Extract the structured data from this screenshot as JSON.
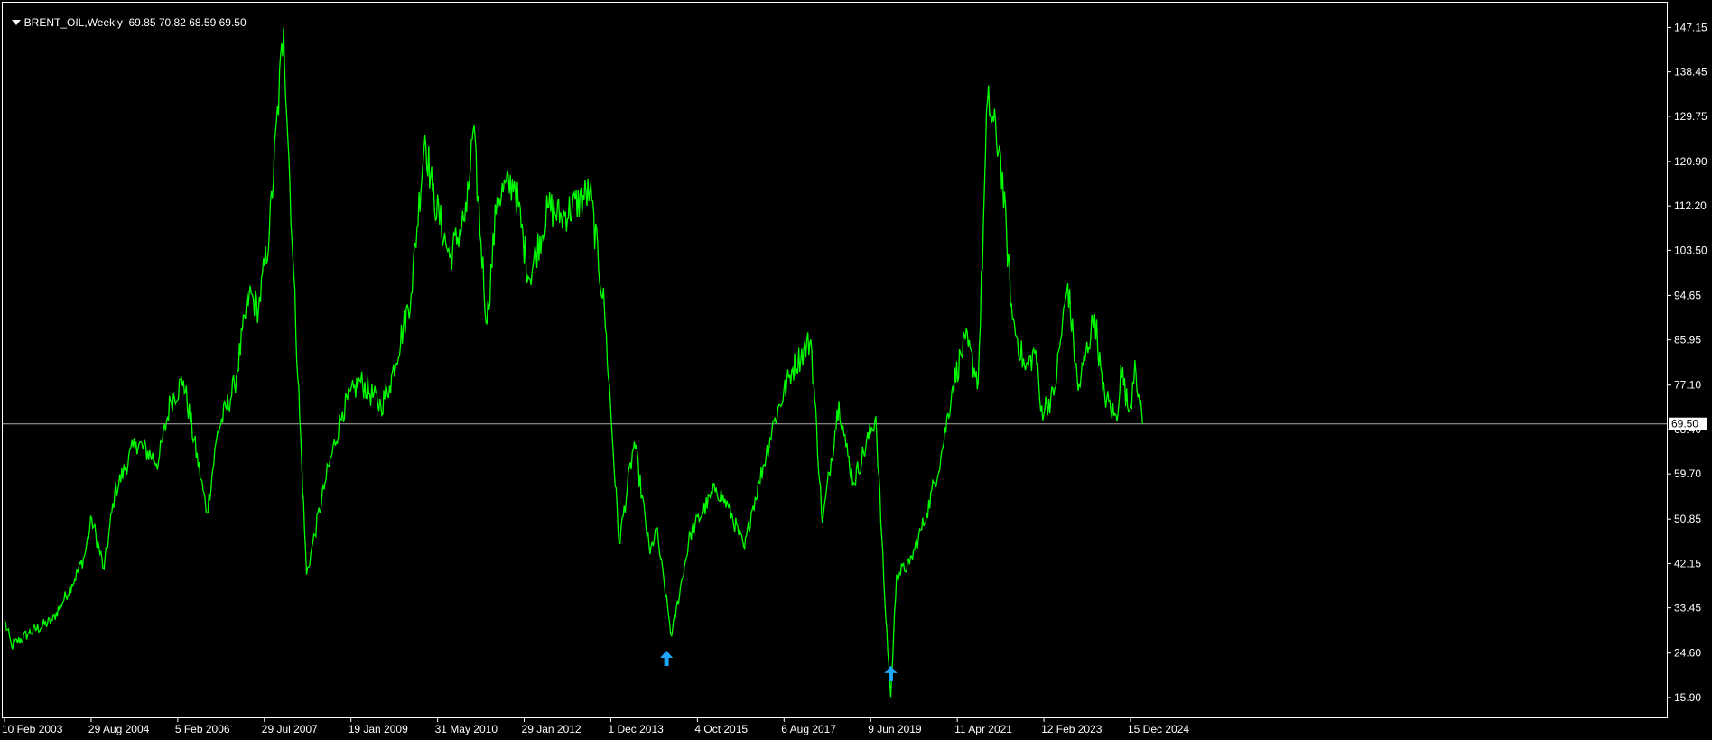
{
  "header": {
    "symbol": "BRENT_OIL,Weekly",
    "ohlc": "69.85 70.82 68.59 69.50"
  },
  "colors": {
    "background": "#000000",
    "price_line": "#00FF00",
    "arrow": "#1EA7FD",
    "grid_frame": "#FFFFFF",
    "current_line": "#B0B0B0"
  },
  "chart_data": {
    "type": "line",
    "title": "",
    "xlabel": "",
    "ylabel": "",
    "grid": false,
    "ylim": [
      12.0,
      152.0
    ],
    "y_ticks": [
      "147.15",
      "138.45",
      "129.75",
      "120.90",
      "112.20",
      "103.50",
      "94.65",
      "85.95",
      "77.10",
      "68.40",
      "59.70",
      "50.85",
      "42.15",
      "33.45",
      "24.60",
      "15.90"
    ],
    "x_ticks": [
      "10 Feb 2003",
      "29 Aug 2004",
      "5 Feb 2006",
      "29 Jul 2007",
      "19 Jan 2009",
      "31 May 2010",
      "29 Jan 2012",
      "1 Dec 2013",
      "4 Oct 2015",
      "6 Aug 2017",
      "9 Jun 2019",
      "11 Apr 2021",
      "12 Feb 2023",
      "15 Dec 2024"
    ],
    "current_value": "69.50",
    "series": [
      {
        "x": [
          "2003-02-10",
          "2003-04-01",
          "2003-08-01",
          "2004-01-15",
          "2004-06-01",
          "2004-08-29",
          "2004-10-20",
          "2005-01-15",
          "2005-04-01",
          "2005-08-30",
          "2006-02-05",
          "2006-05-01",
          "2006-08-01",
          "2007-01-15",
          "2007-04-01",
          "2007-07-29",
          "2007-11-10",
          "2008-01-15",
          "2008-04-01",
          "2008-07-11",
          "2008-09-15",
          "2008-12-20",
          "2009-01-19",
          "2009-05-01",
          "2009-09-01",
          "2010-01-01",
          "2010-05-31",
          "2010-08-01",
          "2011-01-01",
          "2011-04-08",
          "2011-06-01",
          "2011-10-01",
          "2012-01-29",
          "2012-03-15",
          "2012-06-20",
          "2012-09-01",
          "2013-01-01",
          "2013-04-15",
          "2013-09-01",
          "2013-12-01",
          "2014-06-20",
          "2014-10-01",
          "2015-01-13",
          "2015-05-01",
          "2015-08-20",
          "2015-10-04",
          "2016-01-20",
          "2016-06-01",
          "2016-12-01",
          "2017-03-01",
          "2017-06-20",
          "2017-08-06",
          "2017-10-01",
          "2018-01-15",
          "2018-05-20",
          "2018-10-03",
          "2018-12-24",
          "2019-04-20",
          "2019-06-09",
          "2019-08-01",
          "2020-01-06",
          "2020-03-10",
          "2020-04-21",
          "2020-06-01",
          "2020-09-01",
          "2021-01-01",
          "2021-04-11",
          "2021-07-05",
          "2021-10-01",
          "2022-01-01",
          "2022-03-08",
          "2022-06-08",
          "2022-09-01",
          "2022-12-01",
          "2023-02-12",
          "2023-03-20",
          "2023-06-20",
          "2023-09-27",
          "2023-12-10",
          "2024-04-05",
          "2024-06-01",
          "2024-09-10",
          "2024-10-07",
          "2024-12-01",
          "2024-12-15",
          "2025-01-15",
          "2025-02-20",
          "2025-03-10"
        ],
        "y": [
          31.0,
          26.0,
          28.5,
          31.0,
          38.0,
          43.5,
          51.0,
          41.0,
          56.0,
          66.0,
          62.0,
          74.0,
          78.0,
          52.0,
          68.0,
          77.0,
          95.0,
          92.0,
          107.0,
          147.15,
          102.0,
          40.0,
          44.0,
          58.0,
          72.0,
          78.0,
          73.0,
          77.0,
          95.0,
          126.0,
          115.0,
          102.0,
          111.0,
          127.0,
          89.0,
          114.0,
          117.0,
          98.0,
          112.0,
          110.0,
          115.0,
          92.0,
          46.0,
          66.0,
          44.0,
          49.0,
          27.88,
          48.0,
          57.0,
          53.0,
          45.0,
          52.0,
          58.0,
          70.0,
          80.0,
          86.0,
          50.0,
          74.0,
          65.0,
          58.0,
          71.0,
          35.0,
          16.0,
          40.0,
          42.0,
          52.0,
          63.0,
          77.0,
          86.0,
          78.0,
          133.0,
          122.0,
          90.0,
          80.0,
          84.0,
          72.0,
          75.0,
          97.0,
          76.0,
          91.0,
          76.0,
          70.0,
          81.0,
          72.0,
          73.0,
          82.0,
          73.0,
          69.5
        ]
      }
    ],
    "markers": [
      {
        "type": "arrow-up",
        "x": "2015-12-15",
        "y": 23.5
      },
      {
        "type": "arrow-up",
        "x": "2020-04-21",
        "y": 20.5
      }
    ]
  }
}
